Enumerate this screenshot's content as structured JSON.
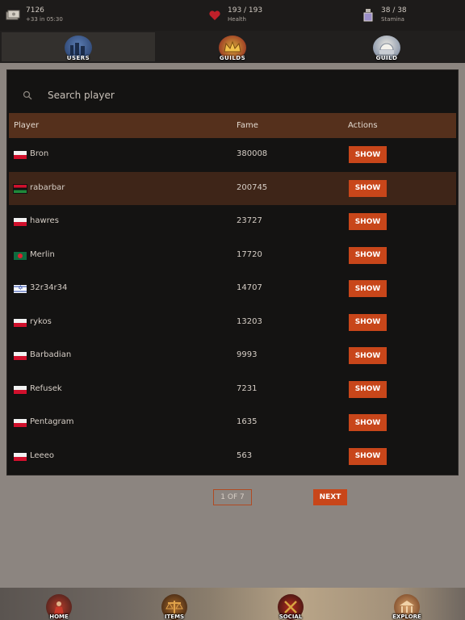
{
  "status": {
    "money": {
      "value": "7126",
      "sub": "+33 in 05:30",
      "icon": "money-icon"
    },
    "health": {
      "value": "193 / 193",
      "sub": "Health",
      "icon": "heart-icon"
    },
    "stamina": {
      "value": "38 / 38",
      "sub": "Stamina",
      "icon": "potion-icon"
    }
  },
  "tabs": [
    {
      "label": "USERS",
      "icon": "users-emblem-icon",
      "active": true
    },
    {
      "label": "GUILDS",
      "icon": "crown-icon",
      "active": false
    },
    {
      "label": "GUILD",
      "icon": "dome-icon",
      "active": false
    }
  ],
  "search": {
    "placeholder": "Search player"
  },
  "table": {
    "headers": {
      "player": "Player",
      "fame": "Fame",
      "actions": "Actions"
    },
    "rows": [
      {
        "name": "Bron",
        "fame": "380008",
        "flag": "pl",
        "action": "SHOW"
      },
      {
        "name": "rabarbar",
        "fame": "200745",
        "flag": "ly",
        "action": "SHOW"
      },
      {
        "name": "hawres",
        "fame": "23727",
        "flag": "pl",
        "action": "SHOW"
      },
      {
        "name": "Merlin",
        "fame": "17720",
        "flag": "bd",
        "action": "SHOW"
      },
      {
        "name": "32r34r34",
        "fame": "14707",
        "flag": "il",
        "action": "SHOW"
      },
      {
        "name": "rykos",
        "fame": "13203",
        "flag": "pl",
        "action": "SHOW"
      },
      {
        "name": "Barbadian",
        "fame": "9993",
        "flag": "pl",
        "action": "SHOW"
      },
      {
        "name": "Refusek",
        "fame": "7231",
        "flag": "pl",
        "action": "SHOW"
      },
      {
        "name": "Pentagram",
        "fame": "1635",
        "flag": "pl",
        "action": "SHOW"
      },
      {
        "name": "Leeeo",
        "fame": "563",
        "flag": "pl",
        "action": "SHOW"
      }
    ]
  },
  "pagination": {
    "indicator": "1 OF 7",
    "next_label": "NEXT"
  },
  "bottom_nav": [
    {
      "label": "HOME",
      "icon": "home-emblem-icon"
    },
    {
      "label": "ITEMS",
      "icon": "scales-icon"
    },
    {
      "label": "SOCIAL",
      "icon": "crossed-swords-icon"
    },
    {
      "label": "EXPLORE",
      "icon": "temple-icon"
    }
  ],
  "colors": {
    "accent": "#c8461a",
    "header_bg": "#55301c",
    "highlight_row": "#3e2518"
  }
}
